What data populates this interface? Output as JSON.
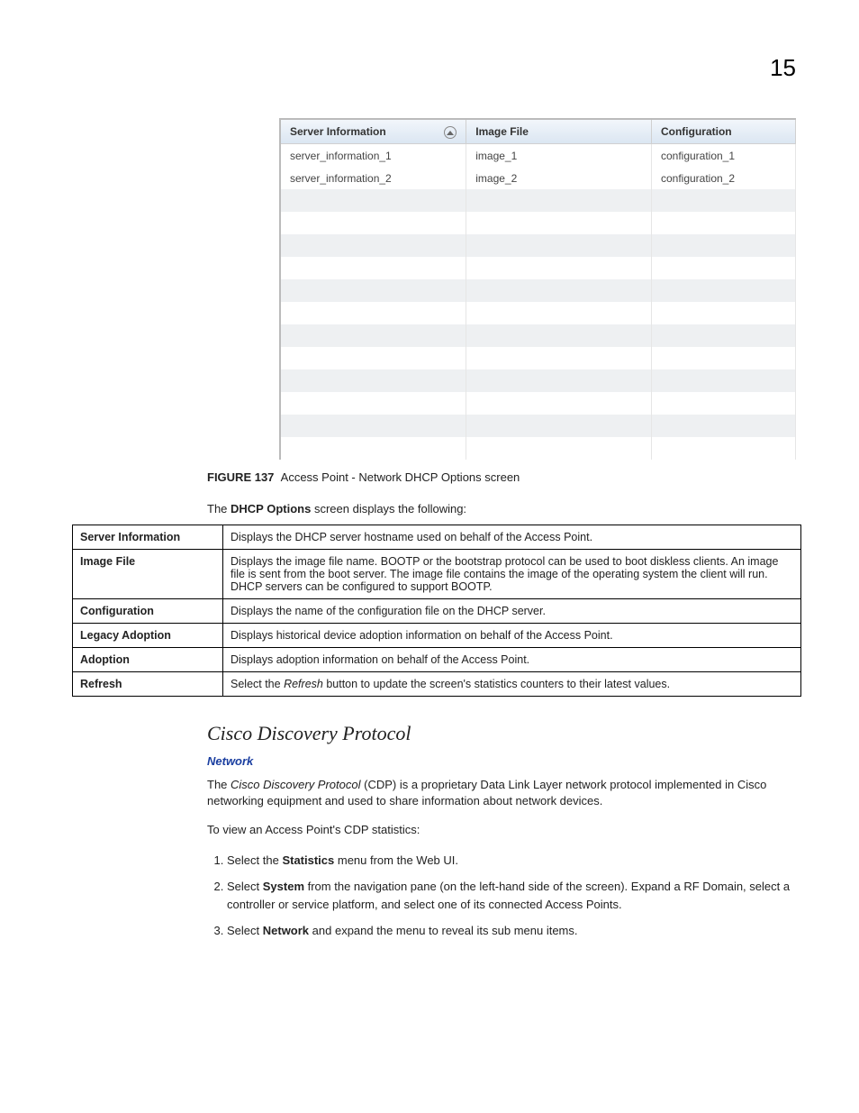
{
  "page_number": "15",
  "grid": {
    "headers": [
      "Server Information",
      "Image File",
      "Configuration"
    ],
    "rows": [
      [
        "server_information_1",
        "image_1",
        "configuration_1"
      ],
      [
        "server_information_2",
        "image_2",
        "configuration_2"
      ],
      [
        "",
        "",
        ""
      ],
      [
        "",
        "",
        ""
      ],
      [
        "",
        "",
        ""
      ],
      [
        "",
        "",
        ""
      ],
      [
        "",
        "",
        ""
      ],
      [
        "",
        "",
        ""
      ],
      [
        "",
        "",
        ""
      ],
      [
        "",
        "",
        ""
      ],
      [
        "",
        "",
        ""
      ],
      [
        "",
        "",
        ""
      ],
      [
        "",
        "",
        ""
      ],
      [
        "",
        "",
        ""
      ]
    ]
  },
  "figure_label": "FIGURE 137",
  "figure_title": "Access Point - Network DHCP Options screen",
  "intro_pre": "The ",
  "intro_strong": "DHCP Options",
  "intro_post": " screen displays the following:",
  "definitions": [
    {
      "term": "Server Information",
      "desc": "Displays the DHCP server hostname used on behalf of the Access Point."
    },
    {
      "term": "Image File",
      "desc": "Displays the image file name. BOOTP or the bootstrap protocol can be used to boot diskless clients. An image file is sent from the boot server. The image file contains the image of the operating system the client will run. DHCP servers can be configured to support BOOTP."
    },
    {
      "term": "Configuration",
      "desc": "Displays the name of the configuration file on the DHCP server."
    },
    {
      "term": "Legacy Adoption",
      "desc": "Displays historical device adoption information on behalf of the Access Point."
    },
    {
      "term": "Adoption",
      "desc": "Displays adoption information on behalf of the Access Point."
    },
    {
      "term": "Refresh",
      "desc_pre": "Select the ",
      "desc_em": "Refresh",
      "desc_post": " button to update the screen's statistics counters to their latest values."
    }
  ],
  "section_title": "Cisco Discovery Protocol",
  "network_link": "Network",
  "cdp_para_pre": "The ",
  "cdp_para_em": "Cisco Discovery Protocol",
  "cdp_para_post": " (CDP) is a proprietary Data Link Layer network protocol implemented in Cisco networking equipment and used to share information about network devices.",
  "view_line": "To view an Access Point's CDP statistics:",
  "steps": [
    {
      "pre": "Select the ",
      "strong": "Statistics",
      "post": " menu from the Web UI."
    },
    {
      "pre": "Select ",
      "strong": "System",
      "post": " from the navigation pane (on the left-hand side of the screen). Expand a RF Domain, select a controller or service platform, and select one of its connected Access Points."
    },
    {
      "pre": "Select ",
      "strong": "Network",
      "post": " and expand the menu to reveal its sub menu items."
    }
  ]
}
